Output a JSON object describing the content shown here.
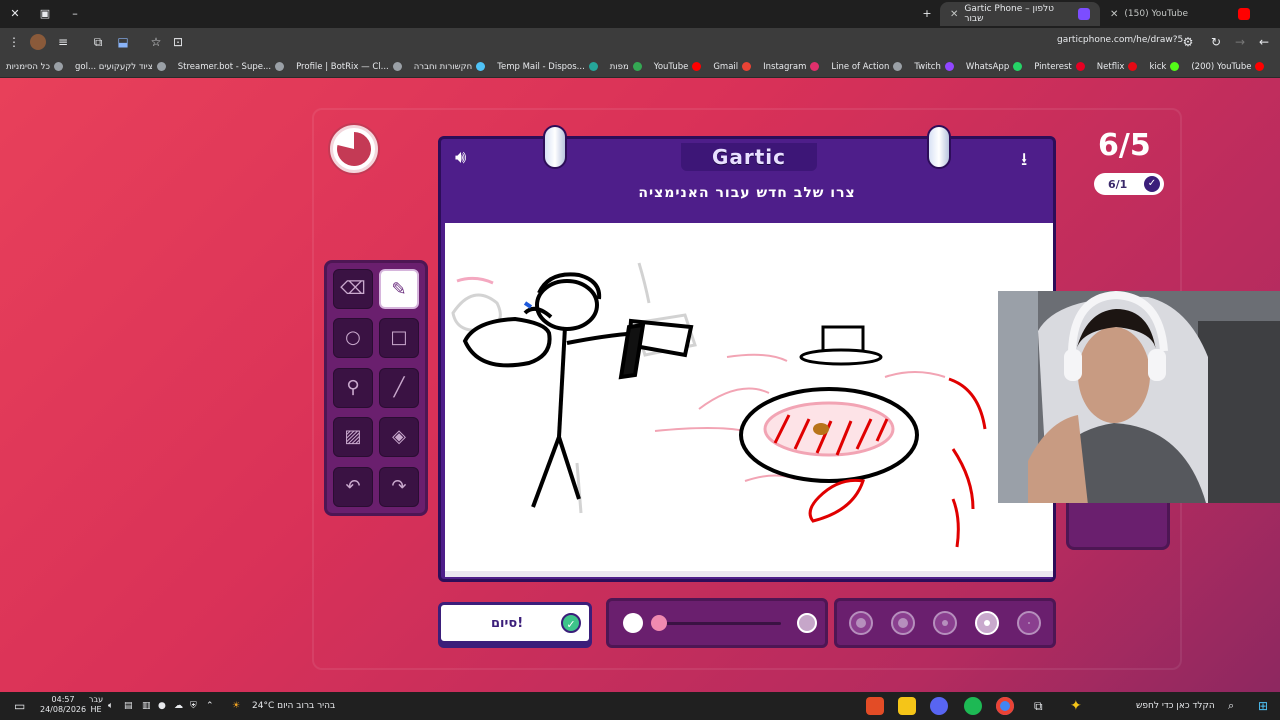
{
  "browser": {
    "tabs": [
      {
        "label": "Gartic Phone – טלפון שבור",
        "active": true,
        "favicon_color": "#7c4dff"
      },
      {
        "label": "(150) YouTube",
        "active": false,
        "favicon_color": "#ff0000"
      }
    ],
    "url": "garticphone.com/he/draw?5",
    "bookmarks": [
      {
        "label": "כל הסימניות",
        "color": "#9aa0a6"
      },
      {
        "label": "gol... ציוד לקעקועים",
        "color": "#9aa0a6"
      },
      {
        "label": "Streamer.bot - Supe...",
        "color": "#9aa0a6"
      },
      {
        "label": "Profile | BotRix — Cl...",
        "color": "#9aa0a6"
      },
      {
        "label": "חקשורות וחברה",
        "color": "#4fc3f7"
      },
      {
        "label": "Temp Mail - Dispos...",
        "color": "#26a69a"
      },
      {
        "label": "מפות",
        "color": "#34a853"
      },
      {
        "label": "YouTube",
        "color": "#ff0000"
      },
      {
        "label": "Gmail",
        "color": "#ea4335"
      },
      {
        "label": "Instagram",
        "color": "#e1306c"
      },
      {
        "label": "Line of Action",
        "color": "#9aa0a6"
      },
      {
        "label": "Twitch",
        "color": "#9146ff"
      },
      {
        "label": "WhatsApp",
        "color": "#25d366"
      },
      {
        "label": "Pinterest",
        "color": "#e60023"
      },
      {
        "label": "Netflix",
        "color": "#e50914"
      },
      {
        "label": "kick",
        "color": "#53fc18"
      },
      {
        "label": "(200) YouTube",
        "color": "#ff0000"
      }
    ]
  },
  "game": {
    "logo": "Gartic",
    "prompt": "צרו שלב חדש עבור האנימציה",
    "round_counter": "6/5",
    "progress_pill": "6/1",
    "done_label": "סיום!",
    "tools": [
      {
        "name": "eraser-tool",
        "icon": "eraser-icon",
        "glyph": "⌫",
        "active": false
      },
      {
        "name": "pencil-tool",
        "icon": "pencil-icon",
        "glyph": "✎",
        "active": true
      },
      {
        "name": "circle-tool",
        "icon": "circle-icon",
        "glyph": "○",
        "active": false
      },
      {
        "name": "rectangle-tool",
        "icon": "rectangle-icon",
        "glyph": "□",
        "active": false
      },
      {
        "name": "eyedropper-tool",
        "icon": "eyedropper-icon",
        "glyph": "⚲",
        "active": false
      },
      {
        "name": "line-tool",
        "icon": "line-icon",
        "glyph": "╱",
        "active": false
      },
      {
        "name": "layer-tool",
        "icon": "layer-icon",
        "glyph": "▨",
        "active": false
      },
      {
        "name": "fill-tool",
        "icon": "fill-bucket-icon",
        "glyph": "◈",
        "active": false
      },
      {
        "name": "undo-tool",
        "icon": "undo-icon",
        "glyph": "↶",
        "active": false
      },
      {
        "name": "redo-tool",
        "icon": "redo-icon",
        "glyph": "↷",
        "active": false
      }
    ],
    "palette_colors": [
      "#c9545c",
      "#8a0a3a",
      "#c8861a",
      "#f4a8b0",
      "#f50a8c",
      "#f5c518"
    ],
    "selected_color": "#f00a0a",
    "brush_sizes": 5,
    "selected_brush_index": 3
  },
  "taskbar": {
    "search_placeholder": "הקלד כאן כדי לחפש",
    "weather": "24°C  בהיר ברוב היום",
    "time": "04:57",
    "date": "24/08/2026",
    "lang": "עבר HE"
  }
}
